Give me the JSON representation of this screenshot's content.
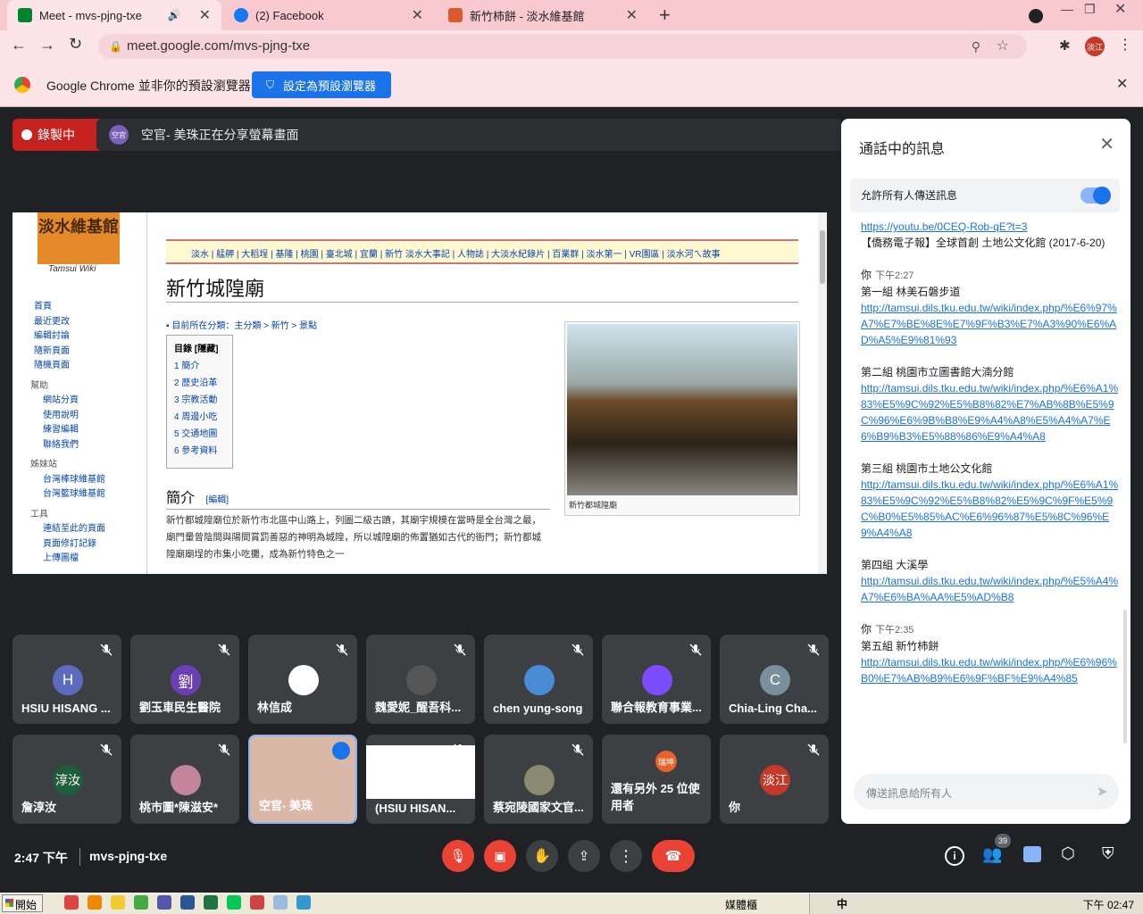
{
  "browser": {
    "tabs": [
      {
        "title": "Meet - mvs-pjng-txe",
        "favicon": "meet-icon",
        "color": "#00832d"
      },
      {
        "title": "(2) Facebook",
        "favicon": "facebook-icon",
        "color": "#1877f2"
      },
      {
        "title": "新竹柿餅 - 淡水維基館",
        "favicon": "wiki-icon",
        "color": "#d95b2b"
      }
    ],
    "url": "meet.google.com/mvs-pjng-txe",
    "profile_label": "淡江",
    "infobar_message": "Google Chrome 並非你的預設瀏覽器",
    "infobar_button": "設定為預設瀏覽器"
  },
  "meet": {
    "recording_label": "錄製中",
    "presenter_badge": "空官",
    "presenting_text": "空官- 美珠正在分享螢幕畫面",
    "shared_page": {
      "logo_text": "淡水維基館",
      "logo_sub": "Tamsui Wiki",
      "nav_links": "淡水 | 艋舺 | 大稻埕 | 基隆 | 桃園 | 臺北城 | 宜蘭 | 新竹    淡水大事記 | 人物誌 | 大淡水紀錄片 | 百業群 | 淡水第一 | VR園區 | 淡水河ㄟ故事",
      "heading": "新竹城隍廟",
      "breadcrumb": "▪ 目前所在分類：主分類 > 新竹 > 景點",
      "toc_title": "目錄 [隱藏]",
      "toc": [
        "1  簡介",
        "2  歷史沿革",
        "3  宗教活動",
        "4  周邊小吃",
        "5  交通地圖",
        "6  參考資料"
      ],
      "image_caption": "新竹都城隍廟",
      "section_title": "簡介",
      "section_edit": "[編輯]",
      "body_text": "新竹都城隍廟位於新竹市北區中山路上，列圖二級古蹟，其廟宇規模在當時是全台灣之最，廟門暈曾陰間與陽間賞罰善惡的神明為城隍，所以城隍廟的佈置猶如古代的衙門；新竹都城隍廟廟埕的市集小吃攤，成為新竹特色之一",
      "sidebar": [
        "首頁",
        "最近更改",
        "編輯討論",
        "隨新頁面",
        "隨機頁面",
        "幫助",
        "網站分頁",
        "使用說明",
        "練習編輯",
        "聯絡我們",
        "姊妹站",
        "台灣棒球維基館",
        "台灣籃球維基館",
        "工具",
        "連結至此的頁面",
        "頁面修訂記錄",
        "上傳圖檔"
      ]
    },
    "participants": [
      {
        "name": "HSIU HISANG ...",
        "initial": "H",
        "color": "#5c6bc0"
      },
      {
        "name": "劉玉車民生醫院",
        "initial": "劉",
        "color": "#6a3fb5"
      },
      {
        "name": "林信成",
        "initial": "",
        "color": "#ffffff"
      },
      {
        "name": "魏愛妮_醒吾科...",
        "initial": "",
        "color": "#555555"
      },
      {
        "name": "chen yung-song",
        "initial": "",
        "color": "#4a8bd6"
      },
      {
        "name": "聯合報教育事業...",
        "initial": "",
        "color": "#7c4dff"
      },
      {
        "name": "Chia-Ling Cha...",
        "initial": "C",
        "color": "#78909c"
      },
      {
        "name": "詹淳汝",
        "initial": "淳汝",
        "color": "#1e5e3a"
      },
      {
        "name": "桃市圖*陳滋安*",
        "initial": "",
        "color": "#c2859a"
      },
      {
        "name": "空官- 美珠",
        "initial": "",
        "color": "#d9b8a8"
      },
      {
        "name": "(HSIU HISAN...",
        "initial": "",
        "color": "#ffffff"
      },
      {
        "name": "蔡宛陵國家文官...",
        "initial": "",
        "color": "#8a8a70"
      },
      {
        "name": "還有另外 25 位使用者",
        "initial": "瑞坤",
        "color": "#e8632a"
      },
      {
        "name": "你",
        "initial": "淡江",
        "color": "#c53929"
      }
    ],
    "clock": "2:47 下午",
    "meeting_code": "mvs-pjng-txe",
    "participant_count": "39"
  },
  "chat": {
    "title": "通話中的訊息",
    "allow_label": "允許所有人傳送訊息",
    "input_placeholder": "傳送訊息給所有人",
    "messages": [
      {
        "sender": "",
        "time": "",
        "lines": [
          {
            "link": "https://youtu.be/0CEQ-Rob-qE?t=3"
          },
          {
            "text": "【僑務電子報】全球首創 土地公文化館 (2017-6-20)"
          }
        ]
      },
      {
        "sender": "你",
        "time": "下午2:27",
        "lines": [
          {
            "text": "第一組 林美石磐步道"
          },
          {
            "link": "http://tamsui.dils.tku.edu.tw/wiki/index.php/%E6%97%A7%E7%BE%8E%E7%9F%B3%E7%A3%90%E6%AD%A5%E9%81%93"
          }
        ]
      },
      {
        "sender": "",
        "time": "",
        "lines": [
          {
            "text": "第二組 桃園市立圖書館大湳分館"
          },
          {
            "link": "http://tamsui.dils.tku.edu.tw/wiki/index.php/%E6%A1%83%E5%9C%92%E5%B8%82%E7%AB%8B%E5%9C%96%E6%9B%B8%E9%A4%A8%E5%A4%A7%E6%B9%B3%E5%88%86%E9%A4%A8"
          }
        ]
      },
      {
        "sender": "",
        "time": "",
        "lines": [
          {
            "text": "第三組 桃園市土地公文化館"
          },
          {
            "link": "http://tamsui.dils.tku.edu.tw/wiki/index.php/%E6%A1%83%E5%9C%92%E5%B8%82%E5%9C%9F%E5%9C%B0%E5%85%AC%E6%96%87%E5%8C%96%E9%A4%A8"
          }
        ]
      },
      {
        "sender": "",
        "time": "",
        "lines": [
          {
            "text": "第四組 大溪學"
          },
          {
            "link": "http://tamsui.dils.tku.edu.tw/wiki/index.php/%E5%A4%A7%E6%BA%AA%E5%AD%B8"
          }
        ]
      },
      {
        "sender": "你",
        "time": "下午2:35",
        "lines": [
          {
            "text": "第五組 新竹柿餅"
          },
          {
            "link": "http://tamsui.dils.tku.edu.tw/wiki/index.php/%E6%96%B0%E7%AB%B9%E6%9F%BF%E9%A4%85"
          }
        ]
      }
    ]
  },
  "taskbar": {
    "start_label": "開始",
    "ime_label": "媒體櫃",
    "clock": "下午 02:47"
  }
}
